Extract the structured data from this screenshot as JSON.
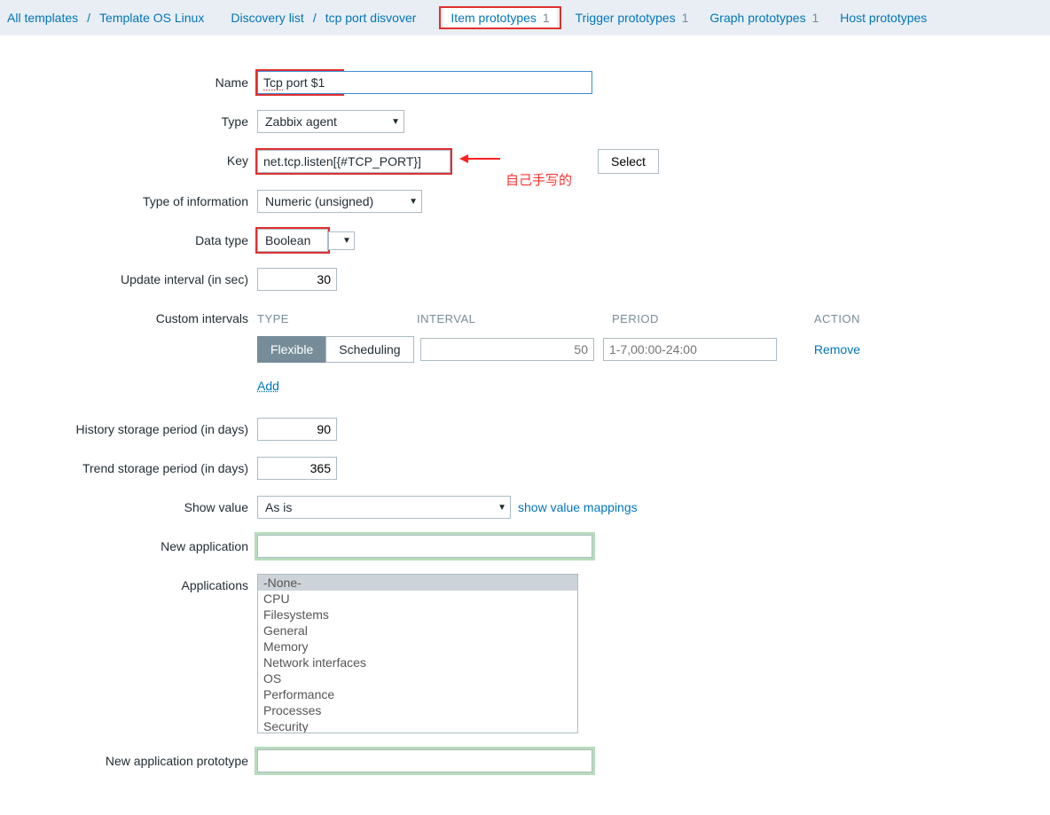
{
  "breadcrumb": {
    "all_templates": "All templates",
    "template": "Template OS Linux",
    "discovery_list": "Discovery list",
    "rule": "tcp port disvover"
  },
  "tabs": {
    "item_proto": "Item prototypes",
    "item_proto_count": "1",
    "trigger_proto": "Trigger prototypes",
    "trigger_proto_count": "1",
    "graph_proto": "Graph prototypes",
    "graph_proto_count": "1",
    "host_proto": "Host prototypes"
  },
  "labels": {
    "name": "Name",
    "type": "Type",
    "key": "Key",
    "info_type": "Type of information",
    "data_type": "Data type",
    "update_interval": "Update interval (in sec)",
    "custom_intervals": "Custom intervals",
    "history": "History storage period (in days)",
    "trend": "Trend storage period (in days)",
    "show_value": "Show value",
    "new_app": "New application",
    "applications": "Applications",
    "new_app_proto": "New application prototype"
  },
  "fields": {
    "name_prefix": "Tcp",
    "name_suffix": " port  $1",
    "type": "Zabbix agent",
    "key": "net.tcp.listen[{#TCP_PORT}]",
    "info_type": "Numeric (unsigned)",
    "data_type": "Boolean",
    "update_interval": "30",
    "history": "90",
    "trend": "365",
    "show_value": "As is",
    "new_app": "",
    "new_app_proto": ""
  },
  "buttons": {
    "select": "Select",
    "flexible": "Flexible",
    "scheduling": "Scheduling",
    "add": "Add",
    "remove": "Remove"
  },
  "links": {
    "show_value_map": "show value mappings"
  },
  "intervals": {
    "head_type": "TYPE",
    "head_interval": "INTERVAL",
    "head_period": "PERIOD",
    "head_action": "ACTION",
    "interval_placeholder": "50",
    "period_placeholder": "1-7,00:00-24:00"
  },
  "applications": [
    "-None-",
    "CPU",
    "Filesystems",
    "General",
    "Memory",
    "Network interfaces",
    "OS",
    "Performance",
    "Processes",
    "Security"
  ],
  "annotation": {
    "note": "自己手写的"
  }
}
